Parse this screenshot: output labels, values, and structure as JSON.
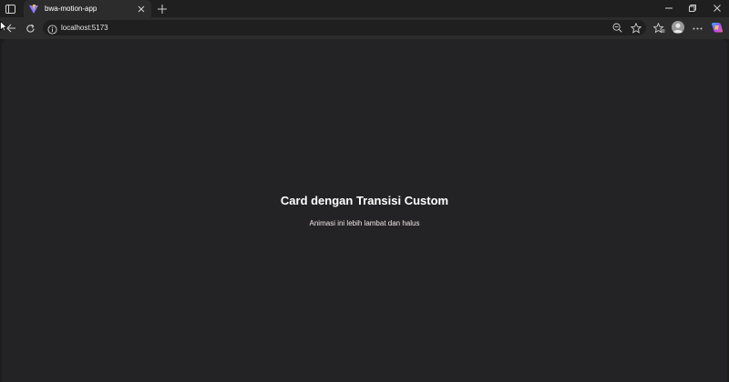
{
  "browser": {
    "tab": {
      "title": "bwa-motion-app"
    },
    "address_bar": {
      "url": "localhost:5173"
    },
    "icons": {
      "sidebar": "tab-actions-icon",
      "close_tab": "close-icon",
      "new_tab": "plus-icon",
      "minimize": "minimize-icon",
      "restore": "restore-icon",
      "close_window": "close-icon",
      "back": "back-arrow-icon",
      "reload": "reload-icon",
      "zoom": "zoom-out-icon",
      "favorite": "star-icon",
      "favorites": "favorites-icon",
      "profile": "avatar-icon",
      "more": "more-icon",
      "copilot": "copilot-icon"
    }
  },
  "page": {
    "card": {
      "title": "Card dengan Transisi Custom",
      "subtitle": "Animasi ini lebih lambat dan halus"
    }
  },
  "colors": {
    "page_bg": "#232325",
    "chrome_bg": "#2c2c2c",
    "title_text": "#ffffff",
    "subtitle_text": "#f1e6e6"
  }
}
